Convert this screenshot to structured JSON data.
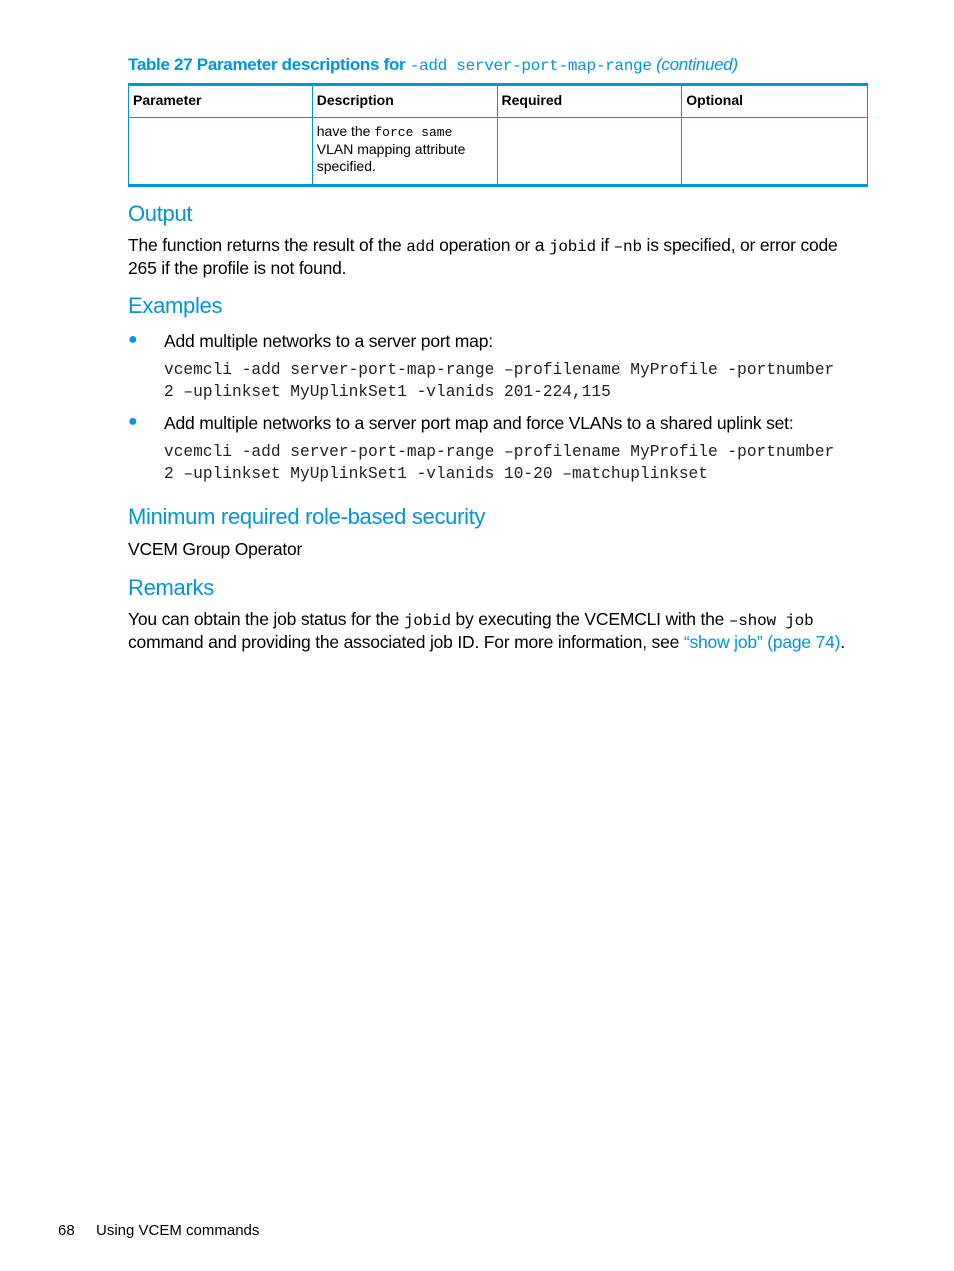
{
  "table": {
    "caption_prefix": "Table 27 Parameter descriptions for ",
    "caption_code": "-add server-port-map-range",
    "caption_suffix": "(continued)",
    "headers": [
      "Parameter",
      "Description",
      "Required",
      "Optional"
    ],
    "row": {
      "parameter": "",
      "description_pre": "have the ",
      "description_code": "force same",
      "description_post": " VLAN mapping attribute specified.",
      "required": "",
      "optional": ""
    }
  },
  "output": {
    "heading": "Output",
    "t1": "The function returns the result of the ",
    "c1": "add",
    "t2": " operation or a ",
    "c2": "jobid",
    "t3": " if ",
    "c3": "–nb",
    "t4": " is specified, or error code 265 if the profile is not found."
  },
  "examples": {
    "heading": "Examples",
    "items": [
      {
        "text": "Add multiple networks to a server port map:",
        "code": "vcemcli -add server-port-map-range –profilename MyProfile -portnumber\n2 –uplinkset MyUplinkSet1 -vlanids 201-224,115"
      },
      {
        "text": "Add multiple networks to a server port map and force VLANs to a shared uplink set:",
        "code": "vcemcli -add server-port-map-range –profilename MyProfile -portnumber\n2 –uplinkset MyUplinkSet1 -vlanids 10-20 –matchuplinkset"
      }
    ]
  },
  "security": {
    "heading": "Minimum required role-based security",
    "text": "VCEM Group Operator"
  },
  "remarks": {
    "heading": "Remarks",
    "t1": "You can obtain the job status for the ",
    "c1": "jobid",
    "t2": " by executing the VCEMCLI with the ",
    "c2": "–show job",
    "t3": " command and providing the associated job ID. For more information, see ",
    "link": "“show job” (page 74)",
    "t4": "."
  },
  "footer": {
    "page_number": "68",
    "title": "Using VCEM commands"
  }
}
